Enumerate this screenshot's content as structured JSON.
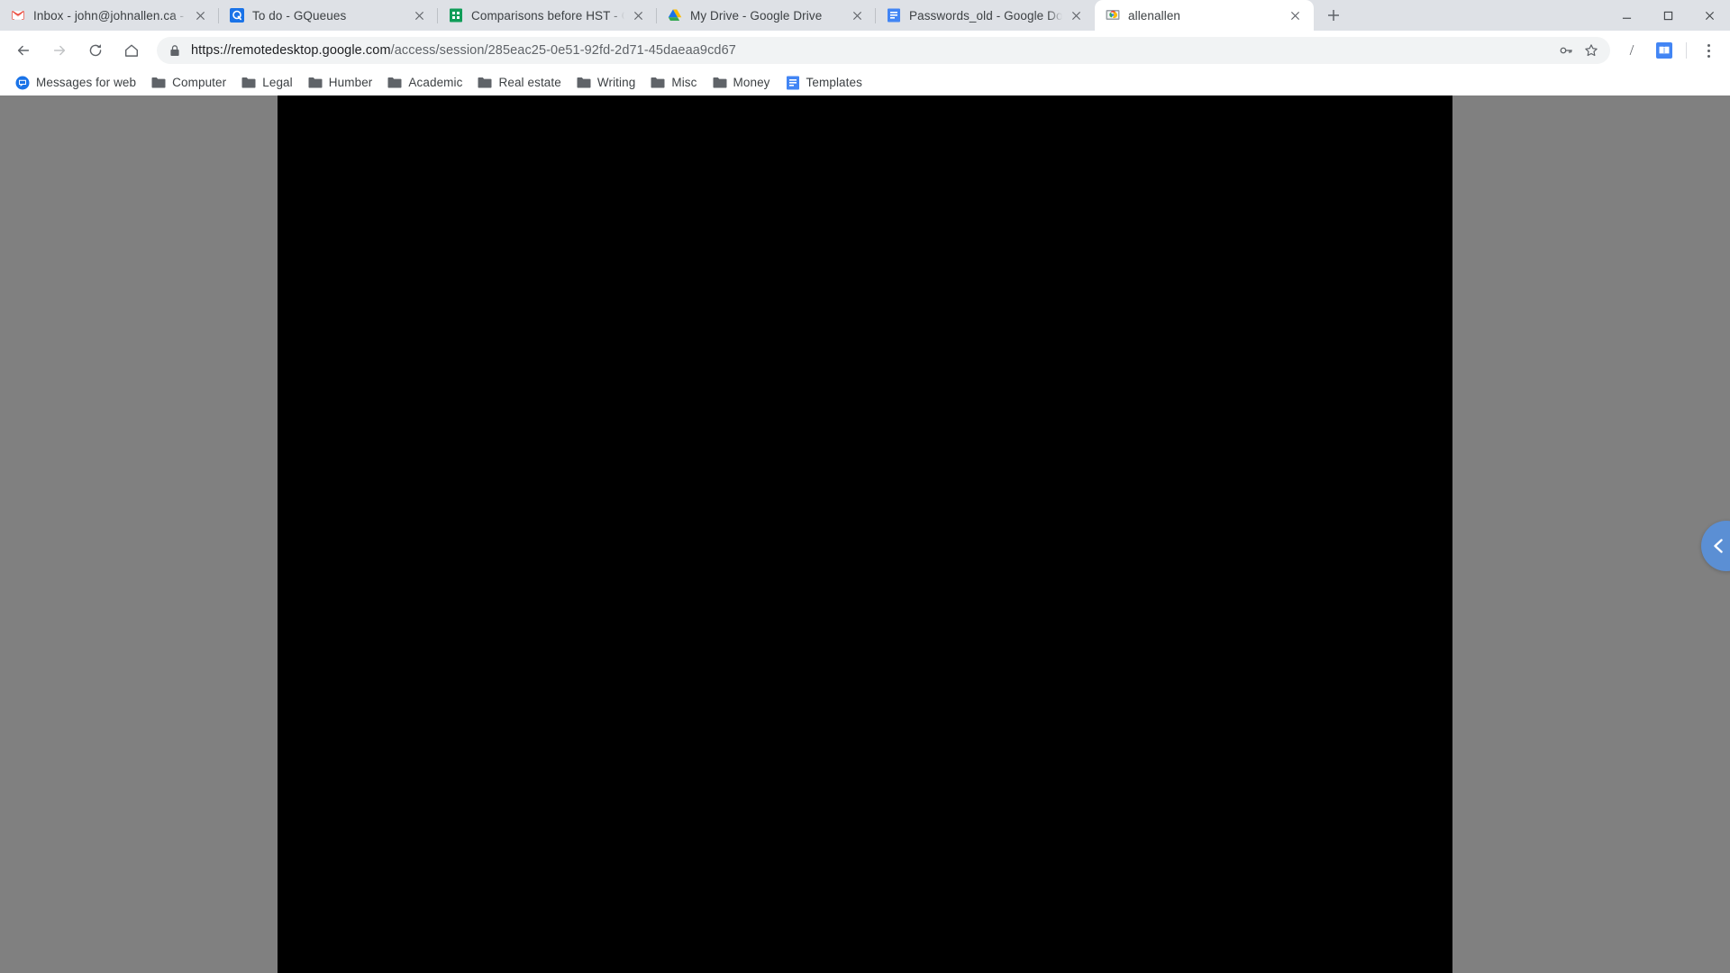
{
  "browser": {
    "tabs": [
      {
        "title": "Inbox - john@johnallen.ca - John...",
        "favicon": "gmail-icon",
        "active": false
      },
      {
        "title": "To do - GQueues",
        "favicon": "gqueues-icon",
        "active": false
      },
      {
        "title": "Comparisons before HST - Goog",
        "favicon": "google-sheets-icon",
        "active": false
      },
      {
        "title": "My Drive - Google Drive",
        "favicon": "google-drive-icon",
        "active": false
      },
      {
        "title": "Passwords_old - Google Docs",
        "favicon": "google-docs-icon",
        "active": false
      },
      {
        "title": "allenallen",
        "favicon": "chrome-remote-desktop-icon",
        "active": true
      }
    ],
    "new_tab_label": "+",
    "window_controls": {
      "minimize": "minimize-icon",
      "maximize": "maximize-icon",
      "close": "close-icon"
    },
    "toolbar": {
      "back": "back-arrow-icon",
      "forward": "forward-arrow-icon",
      "reload": "reload-icon",
      "home": "home-icon",
      "security_icon": "lock-icon",
      "url_host": "https://remotedesktop.google.com",
      "url_path": "/access/session/285eac25-0e51-92fd-2d71-45daeaa9cd67",
      "url_full": "https://remotedesktop.google.com/access/session/285eac25-0e51-92fd-2d71-45daeaa9cd67",
      "password_manager": "key-icon",
      "bookmark_star": "star-icon",
      "extension_slash": "/",
      "extension_dictionary": "book-icon",
      "menu": "three-dot-menu-icon"
    },
    "bookmarks": [
      {
        "label": "Messages for web",
        "icon": "messages-icon"
      },
      {
        "label": "Computer",
        "icon": "folder-icon"
      },
      {
        "label": "Legal",
        "icon": "folder-icon"
      },
      {
        "label": "Humber",
        "icon": "folder-icon"
      },
      {
        "label": "Academic",
        "icon": "folder-icon"
      },
      {
        "label": "Real estate",
        "icon": "folder-icon"
      },
      {
        "label": "Writing",
        "icon": "folder-icon"
      },
      {
        "label": "Misc",
        "icon": "folder-icon"
      },
      {
        "label": "Money",
        "icon": "folder-icon"
      },
      {
        "label": "Templates",
        "icon": "google-docs-icon"
      }
    ]
  },
  "page": {
    "remote_session": {
      "screen_state": "black",
      "background_color": "#808080",
      "screen_color": "#000000"
    },
    "side_panel_toggle": {
      "icon": "chevron-left-icon",
      "color": "#5b8fd4"
    }
  }
}
